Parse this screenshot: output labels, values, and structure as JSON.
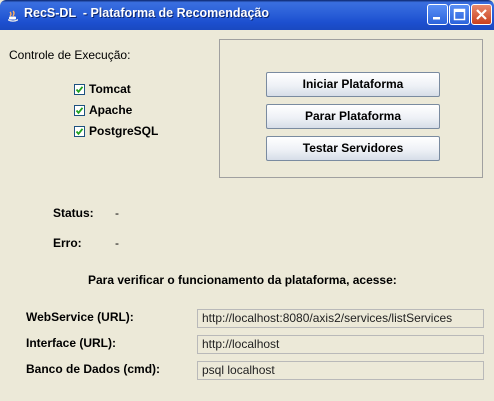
{
  "window": {
    "title": "RecS-DL  - Plataforma de Recomendação"
  },
  "controls": {
    "heading": "Controle de Execução:",
    "checkboxes": [
      {
        "label": "Tomcat",
        "checked": true
      },
      {
        "label": "Apache",
        "checked": true
      },
      {
        "label": "PostgreSQL",
        "checked": true
      }
    ],
    "buttons": {
      "start": "Iniciar Plataforma",
      "stop": "Parar Plataforma",
      "test": "Testar Servidores"
    }
  },
  "status": {
    "status_label": "Status:",
    "status_value": "-",
    "error_label": "Erro:",
    "error_value": "-"
  },
  "info": {
    "message": "Para verificar o funcionamento da plataforma, acesse:"
  },
  "access": [
    {
      "label": "WebService (URL):",
      "value": "http://localhost:8080/axis2/services/listServices"
    },
    {
      "label": "Interface (URL):",
      "value": "http://localhost"
    },
    {
      "label": "Banco de Dados (cmd):",
      "value": "psql localhost"
    }
  ],
  "colors": {
    "titlebar": "#2a5fd8",
    "window_bg": "#ece9d8",
    "close_button": "#c9401e"
  }
}
